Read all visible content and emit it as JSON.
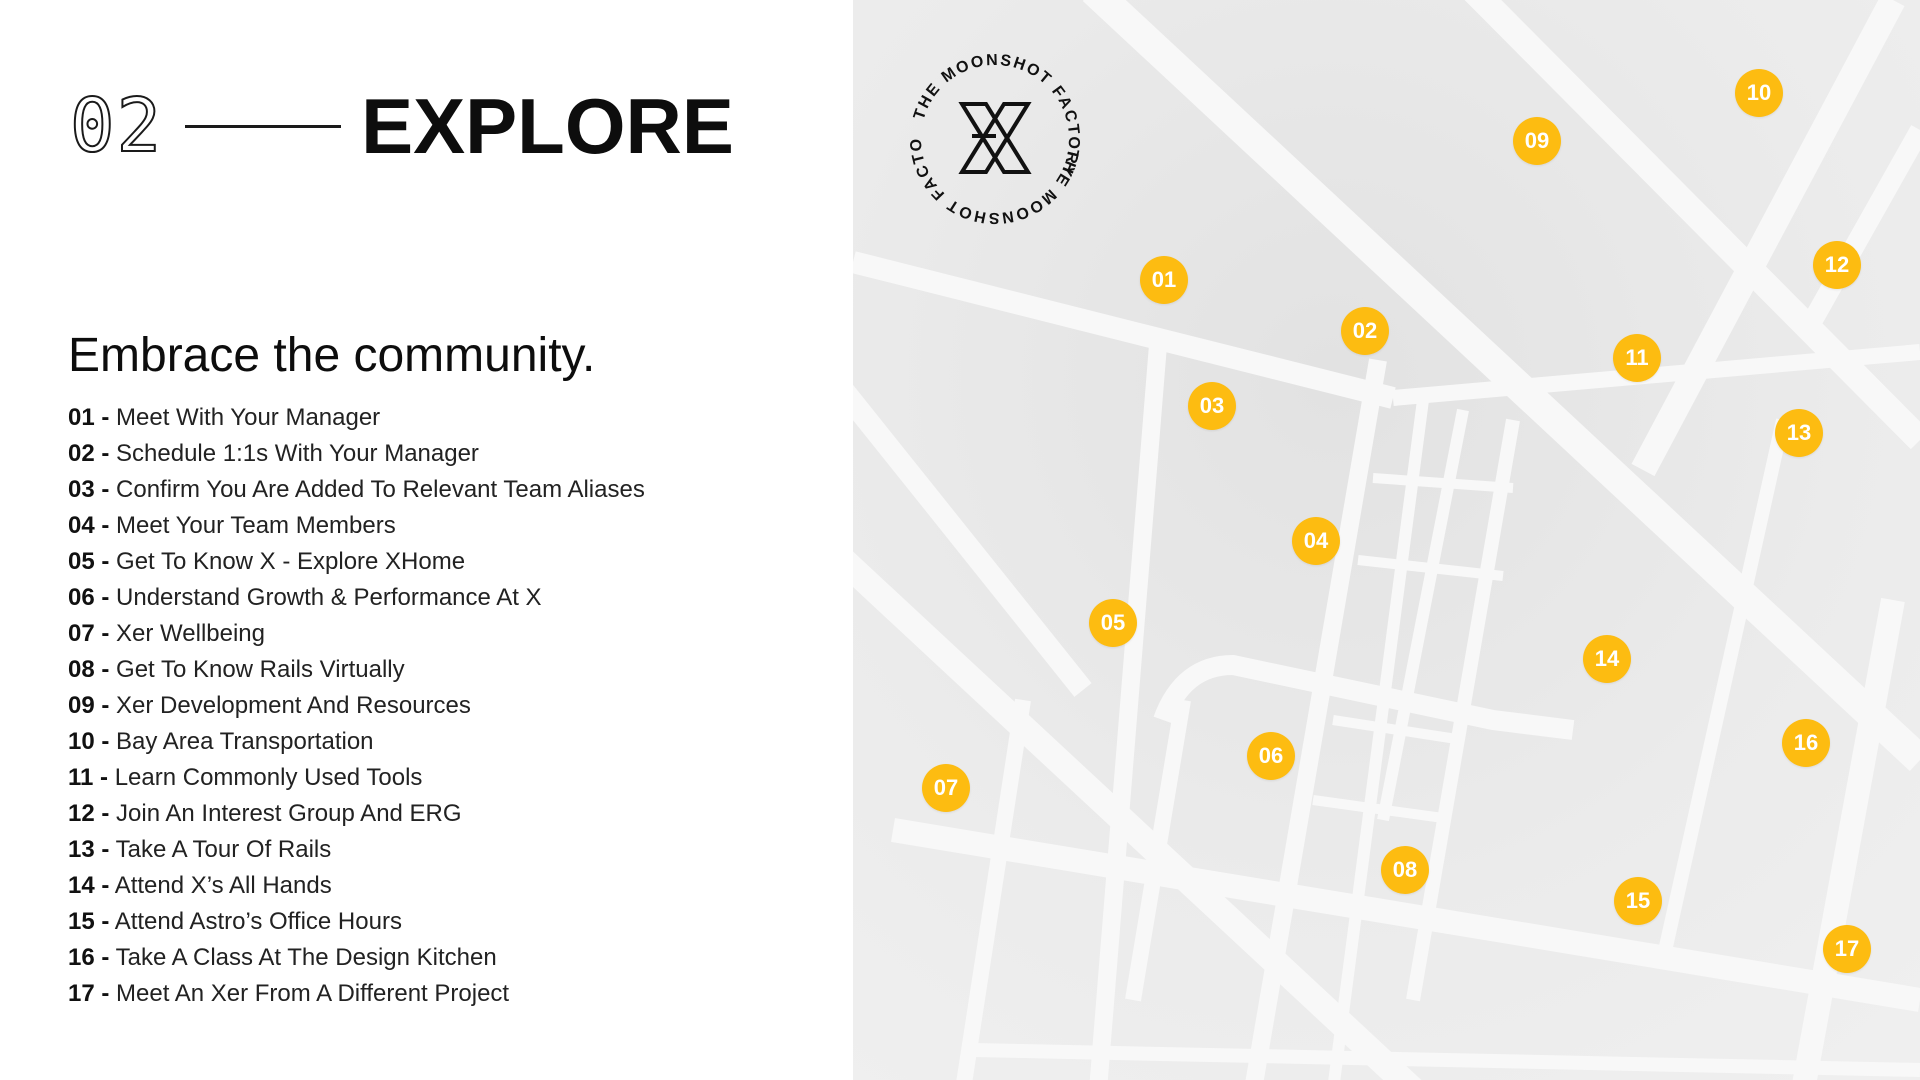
{
  "header": {
    "number": "02",
    "title": "EXPLORE"
  },
  "subtitle": "Embrace the community.",
  "checklist": [
    {
      "num": "01 -",
      "label": "Meet With Your Manager"
    },
    {
      "num": "02 -",
      "label": "Schedule 1:1s With Your Manager"
    },
    {
      "num": "03 -",
      "label": "Confirm You Are Added To Relevant Team Aliases"
    },
    {
      "num": "04 -",
      "label": "Meet Your Team Members"
    },
    {
      "num": "05 -",
      "label": "Get To Know X - Explore XHome"
    },
    {
      "num": "06 -",
      "label": "Understand Growth & Performance At X"
    },
    {
      "num": "07 -",
      "label": "Xer Wellbeing"
    },
    {
      "num": "08 -",
      "label": "Get To Know Rails Virtually"
    },
    {
      "num": "09 -",
      "label": "Xer Development And Resources"
    },
    {
      "num": "10 -",
      "label": "Bay Area Transportation"
    },
    {
      "num": "11 -",
      "label": "Learn Commonly Used Tools"
    },
    {
      "num": "12 -",
      "label": "Join An Interest Group And ERG"
    },
    {
      "num": "13 -",
      "label": "Take A Tour Of Rails"
    },
    {
      "num": "14 -",
      "label": "Attend X’s All Hands"
    },
    {
      "num": "15 -",
      "label": "Attend Astro’s Office Hours"
    },
    {
      "num": "16 -",
      "label": "Take A Class At The Design Kitchen"
    },
    {
      "num": "17 -",
      "label": "Meet An Xer From A Different Project"
    }
  ],
  "badge": {
    "ring_text": "THE MOONSHOT FACTORY",
    "logo": "x-logo-icon"
  },
  "map": {
    "pins": [
      "01",
      "02",
      "03",
      "04",
      "05",
      "06",
      "07",
      "08",
      "09",
      "10",
      "11",
      "12",
      "13",
      "14",
      "15",
      "16",
      "17"
    ]
  },
  "colors": {
    "pin": "#fdbc11",
    "pin_text": "#ffffff",
    "map_bg": "#e9e9e9",
    "road": "#f7f7f7",
    "text": "#111111"
  }
}
